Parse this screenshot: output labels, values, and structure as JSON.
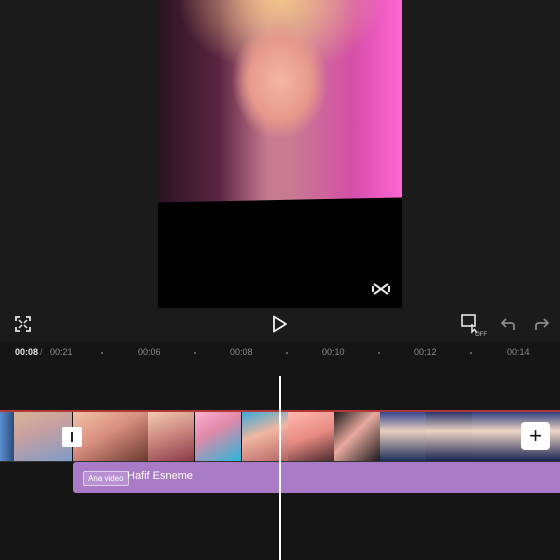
{
  "time_ruler": {
    "current": "00:08",
    "separator": "/",
    "total": "00:21",
    "ticks": [
      "00:06",
      "00:08",
      "00:10",
      "00:12",
      "00:14"
    ]
  },
  "toolbar": {
    "icons": [
      "fullscreen-icon",
      "play-icon",
      "keyframe-off-icon",
      "undo-icon",
      "redo-icon"
    ],
    "keyframe_state": "OFF"
  },
  "audio_track": {
    "badge": "Ana video",
    "title": "Hafif Esneme",
    "color": "#a97ac6"
  },
  "colors": {
    "background": "#1b1b1b",
    "timeline_background": "#151515",
    "clip_border": "#b03a3a",
    "playhead": "#ffffff"
  }
}
